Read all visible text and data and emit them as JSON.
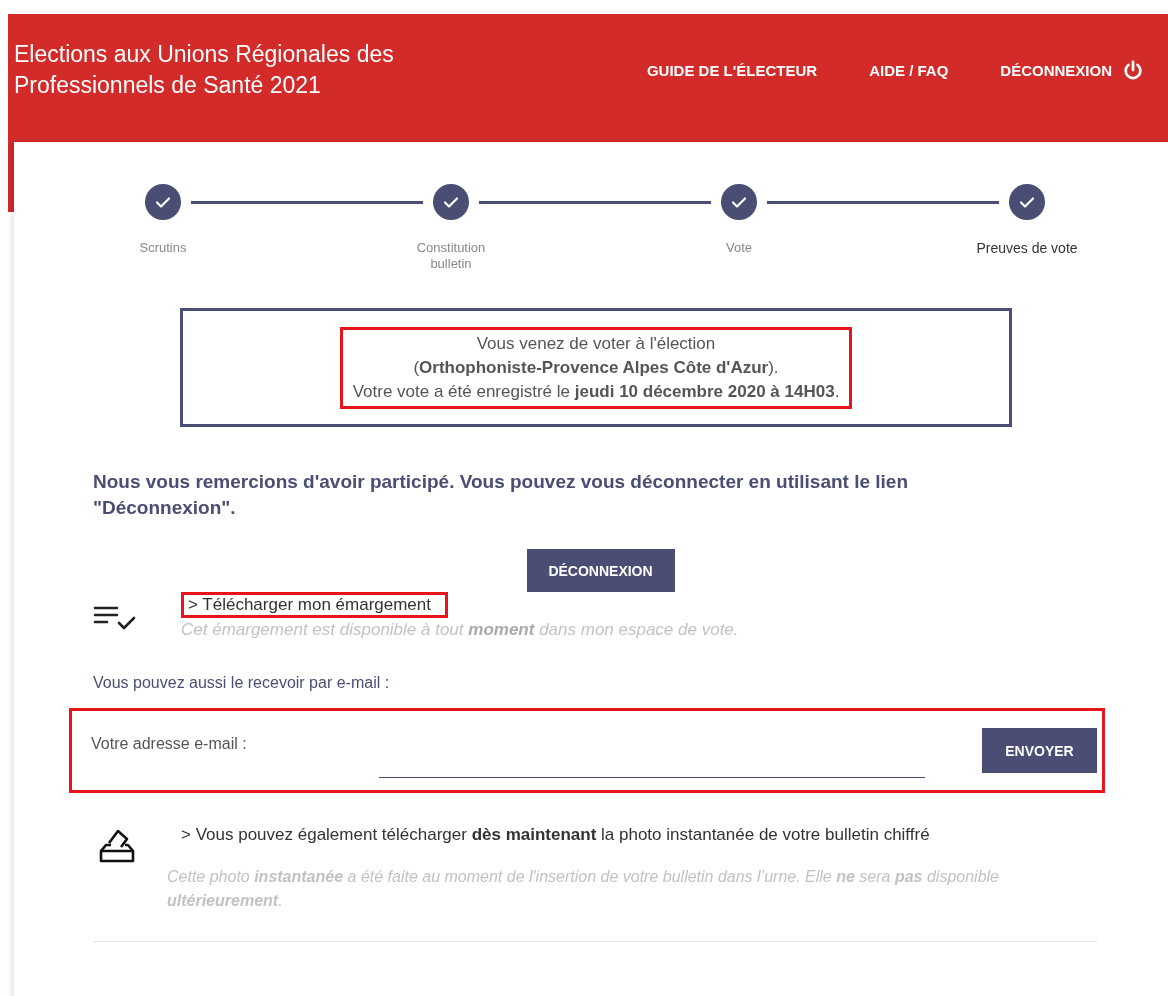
{
  "header": {
    "title": "Elections aux Unions Régionales des Professionnels de Santé 2021",
    "nav": [
      {
        "label": "GUIDE DE L'ÉLECTEUR",
        "kind": "link"
      },
      {
        "label": "AIDE / FAQ",
        "kind": "link"
      },
      {
        "label": "DÉCONNEXION",
        "kind": "logout"
      }
    ]
  },
  "steps": [
    {
      "label": "Scrutins",
      "done": true,
      "selected": false
    },
    {
      "label": "Constitution bulletin",
      "done": true,
      "selected": false
    },
    {
      "label": "Vote",
      "done": true,
      "selected": false
    },
    {
      "label": "Preuves de vote",
      "done": true,
      "selected": true
    }
  ],
  "confirmation": {
    "highlighted": true,
    "lines": [
      "Vous venez de voter à l'élection",
      "(**Orthophoniste-Provence Alpes Côte d'Azur**).",
      "Votre vote a été enregistré le **jeudi 10 décembre 2020 à 14H03**."
    ]
  },
  "thanks": "Nous vous remercions d'avoir participé. Vous pouvez vous déconnecter en utilisant le lien \"Déconnexion\".",
  "logout_button": "DÉCONNEXION",
  "emargement": {
    "link": "> Télécharger mon émargement",
    "highlighted": true,
    "note": "Cet émargement est disponible à tout **moment** dans mon espace de vote."
  },
  "email": {
    "intro": "Vous pouvez aussi le recevoir par e-mail :",
    "label": "Votre adresse e-mail :",
    "button": "ENVOYER",
    "highlighted": true
  },
  "snapshot": {
    "link": "> Vous pouvez également télécharger **dès maintenant** la photo instantanée de votre bulletin chiffré",
    "note": "Cette photo **instantanée** a été faite au moment de l'insertion de votre bulletin dans l’urne. Elle **ne** sera **pas** disponible **ultérieurement**."
  }
}
